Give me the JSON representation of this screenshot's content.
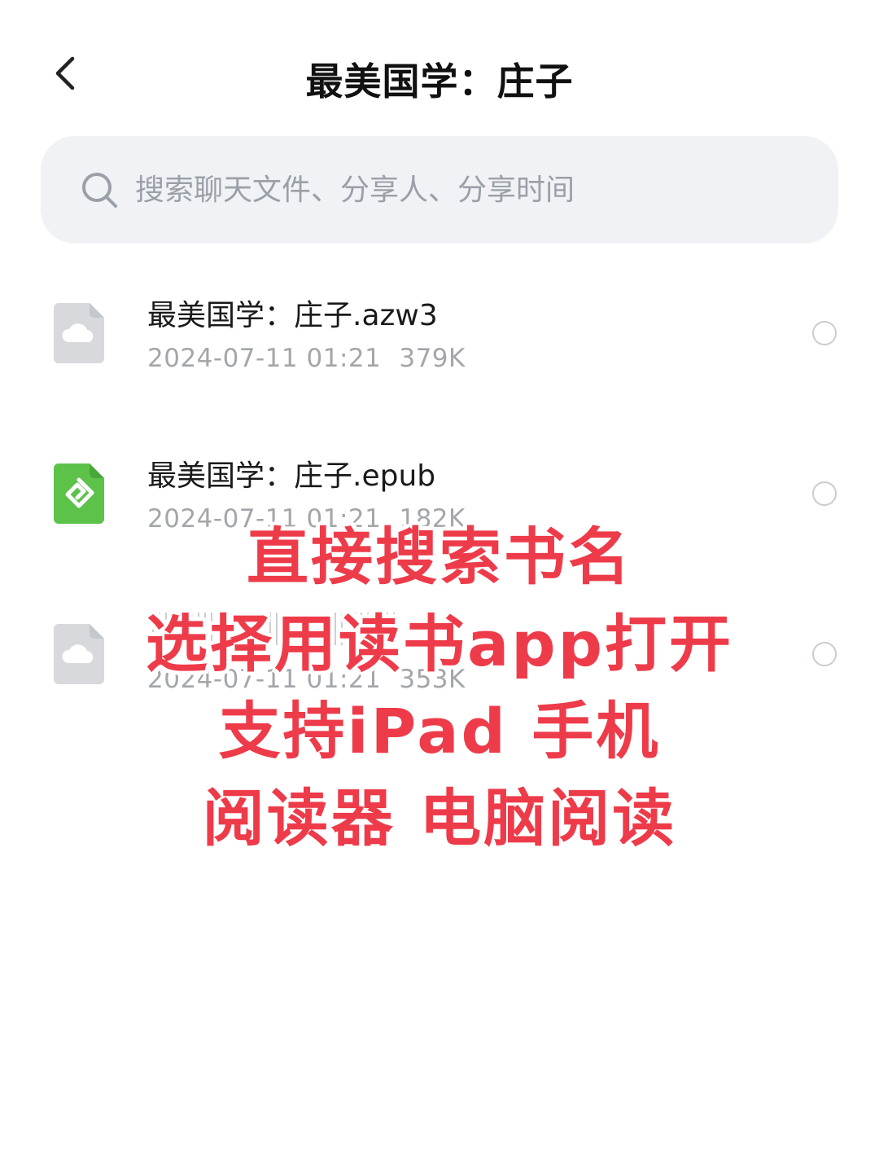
{
  "header": {
    "title": "最美国学：庄子",
    "back_icon": "chevron-left-icon"
  },
  "search": {
    "icon": "search-icon",
    "placeholder": "搜索聊天文件、分享人、分享时间"
  },
  "files": [
    {
      "name": "最美国学：庄子.azw3",
      "date": "2024-07-11 01:21",
      "size": "379K",
      "icon": "cloud-file-icon"
    },
    {
      "name": "最美国学：庄子.epub",
      "date": "2024-07-11 01:21",
      "size": "182K",
      "icon": "epub-file-icon"
    },
    {
      "name": "",
      "date": "2024-07-11 01:21",
      "size": "353K",
      "icon": "cloud-file-icon"
    }
  ],
  "overlay": {
    "lines": [
      "直接搜索书名",
      "选择用读书app打开",
      "支持iPad 手机",
      "阅读器 电脑阅读"
    ]
  },
  "colors": {
    "overlay_text": "#ee3b4a",
    "search_bg": "#f1f2f6",
    "epub_green": "#5cc24a",
    "cloud_file_gray": "#d7d9dd"
  }
}
